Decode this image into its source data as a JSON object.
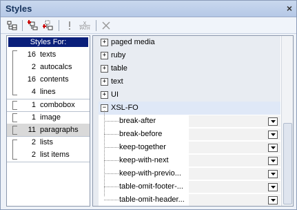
{
  "window": {
    "title": "Styles",
    "close_glyph": "×"
  },
  "toolbar": {
    "buttons": [
      {
        "name": "tree-view-button",
        "icon": "tree-icon"
      },
      {
        "name": "add-style-button",
        "icon": "add-style-icon"
      },
      {
        "name": "add-style-child-button",
        "icon": "add-child-icon"
      },
      {
        "name": "exclamation-button",
        "icon": "exclamation-icon"
      },
      {
        "name": "xpath-button",
        "icon": "xpath-icon",
        "label_top": "X",
        "label_bottom": "PATH"
      },
      {
        "name": "delete-button",
        "icon": "delete-x-icon"
      }
    ]
  },
  "styles_for": {
    "header": "Styles For:",
    "items": [
      {
        "count": "16",
        "label": "texts"
      },
      {
        "count": "2",
        "label": "autocalcs"
      },
      {
        "count": "16",
        "label": "contents"
      },
      {
        "count": "4",
        "label": "lines"
      },
      {
        "count": "1",
        "label": "combobox"
      },
      {
        "count": "1",
        "label": "image"
      },
      {
        "count": "11",
        "label": "paragraphs"
      },
      {
        "count": "2",
        "label": "lists"
      },
      {
        "count": "2",
        "label": "list items"
      }
    ],
    "selected_index": 6
  },
  "properties": {
    "groups": [
      {
        "label": "paged media",
        "expanded": false
      },
      {
        "label": "ruby",
        "expanded": false
      },
      {
        "label": "table",
        "expanded": false
      },
      {
        "label": "text",
        "expanded": false
      },
      {
        "label": "UI",
        "expanded": false
      },
      {
        "label": "XSL-FO",
        "expanded": true
      }
    ],
    "xslfo_props": [
      {
        "label": "break-after",
        "value": ""
      },
      {
        "label": "break-before",
        "value": ""
      },
      {
        "label": "keep-together",
        "value": ""
      },
      {
        "label": "keep-with-next",
        "value": ""
      },
      {
        "label": "keep-with-previo...",
        "value": ""
      },
      {
        "label": "table-omit-footer-...",
        "value": ""
      },
      {
        "label": "table-omit-header...",
        "value": ""
      }
    ],
    "expand_glyph": "+",
    "collapse_glyph": "−"
  },
  "colors": {
    "header_bg": "#0a1f7a",
    "title_color": "#15325c",
    "selected_bg": "#d9d9d9"
  }
}
